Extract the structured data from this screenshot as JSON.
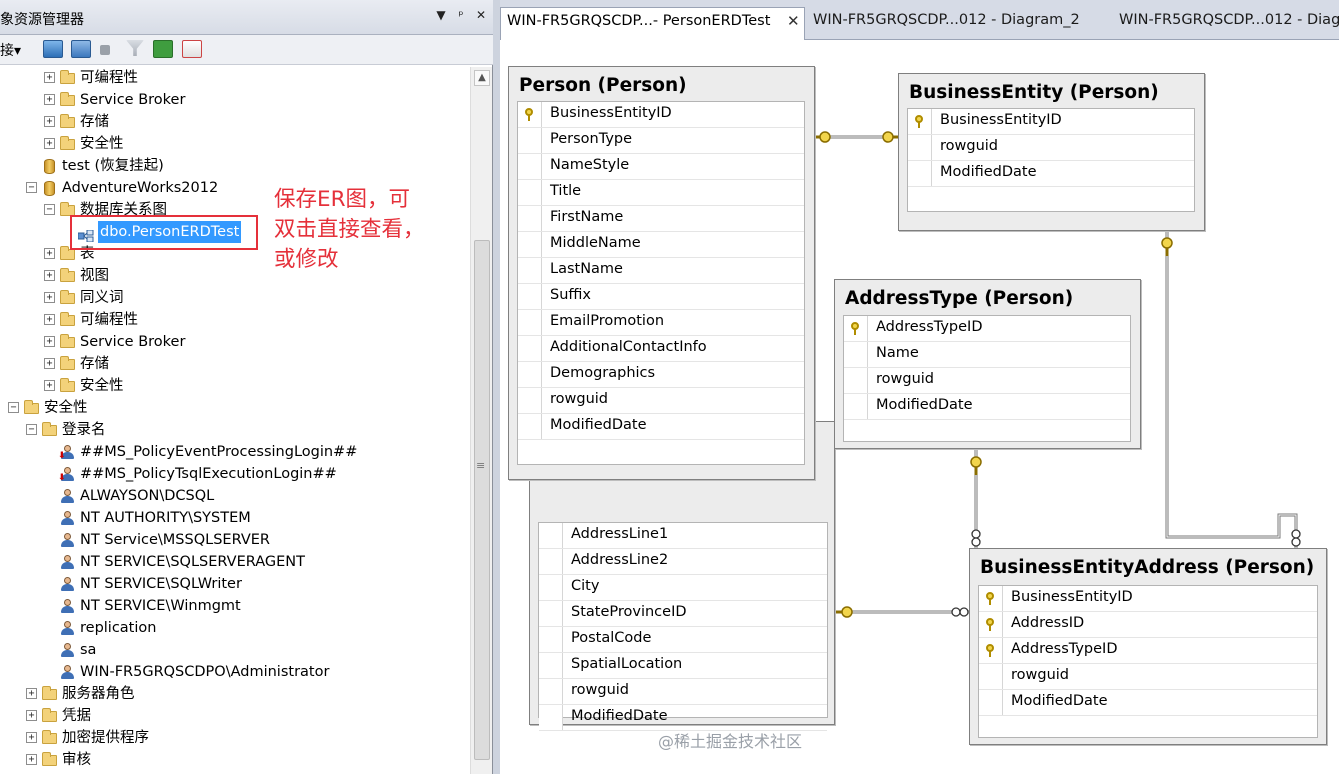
{
  "explorer": {
    "title": "象资源管理器",
    "title_buttons": [
      "▼",
      "ᵖ",
      "✕"
    ],
    "toolbar": {
      "connect_label": "连接▾"
    },
    "tree": [
      {
        "indent": 2,
        "icon": "folder",
        "expander": "+",
        "label": "可编程性"
      },
      {
        "indent": 2,
        "icon": "folder",
        "expander": "+",
        "label": "Service Broker"
      },
      {
        "indent": 2,
        "icon": "folder",
        "expander": "+",
        "label": "存储"
      },
      {
        "indent": 2,
        "icon": "folder",
        "expander": "+",
        "label": "安全性"
      },
      {
        "indent": 1,
        "icon": "database",
        "expander": "",
        "label": "test (恢复挂起)"
      },
      {
        "indent": 1,
        "icon": "database",
        "expander": "−",
        "label": "AdventureWorks2012"
      },
      {
        "indent": 2,
        "icon": "folder",
        "expander": "−",
        "label": "数据库关系图"
      },
      {
        "indent": 3,
        "icon": "diagram",
        "expander": "",
        "label": "dbo.PersonERDTest",
        "selected": true
      },
      {
        "indent": 2,
        "icon": "folder",
        "expander": "+",
        "label": "表"
      },
      {
        "indent": 2,
        "icon": "folder",
        "expander": "+",
        "label": "视图"
      },
      {
        "indent": 2,
        "icon": "folder",
        "expander": "+",
        "label": "同义词"
      },
      {
        "indent": 2,
        "icon": "folder",
        "expander": "+",
        "label": "可编程性"
      },
      {
        "indent": 2,
        "icon": "folder",
        "expander": "+",
        "label": "Service Broker"
      },
      {
        "indent": 2,
        "icon": "folder",
        "expander": "+",
        "label": "存储"
      },
      {
        "indent": 2,
        "icon": "folder",
        "expander": "+",
        "label": "安全性"
      },
      {
        "indent": 0,
        "icon": "folder",
        "expander": "−",
        "label": "安全性"
      },
      {
        "indent": 1,
        "icon": "folder",
        "expander": "−",
        "label": "登录名"
      },
      {
        "indent": 2,
        "icon": "user-disabled",
        "expander": "",
        "label": "##MS_PolicyEventProcessingLogin##"
      },
      {
        "indent": 2,
        "icon": "user-disabled",
        "expander": "",
        "label": "##MS_PolicyTsqlExecutionLogin##"
      },
      {
        "indent": 2,
        "icon": "user",
        "expander": "",
        "label": "ALWAYSON\\DCSQL"
      },
      {
        "indent": 2,
        "icon": "user",
        "expander": "",
        "label": "NT AUTHORITY\\SYSTEM"
      },
      {
        "indent": 2,
        "icon": "user",
        "expander": "",
        "label": "NT Service\\MSSQLSERVER"
      },
      {
        "indent": 2,
        "icon": "user",
        "expander": "",
        "label": "NT SERVICE\\SQLSERVERAGENT"
      },
      {
        "indent": 2,
        "icon": "user",
        "expander": "",
        "label": "NT SERVICE\\SQLWriter"
      },
      {
        "indent": 2,
        "icon": "user",
        "expander": "",
        "label": "NT SERVICE\\Winmgmt"
      },
      {
        "indent": 2,
        "icon": "user",
        "expander": "",
        "label": "replication"
      },
      {
        "indent": 2,
        "icon": "user",
        "expander": "",
        "label": "sa"
      },
      {
        "indent": 2,
        "icon": "user",
        "expander": "",
        "label": "WIN-FR5GRQSCDPO\\Administrator"
      },
      {
        "indent": 1,
        "icon": "folder",
        "expander": "+",
        "label": "服务器角色"
      },
      {
        "indent": 1,
        "icon": "folder",
        "expander": "+",
        "label": "凭据"
      },
      {
        "indent": 1,
        "icon": "folder",
        "expander": "+",
        "label": "加密提供程序"
      },
      {
        "indent": 1,
        "icon": "folder",
        "expander": "+",
        "label": "审核"
      }
    ]
  },
  "annotation": {
    "lines": [
      "保存ER图，可",
      "双击直接查看，",
      "或修改"
    ],
    "color": "#e5303a"
  },
  "tabs": [
    {
      "label": "WIN-FR5GRQSCDP...- PersonERDTest",
      "active": true,
      "close": "✕"
    },
    {
      "label": "WIN-FR5GRQSCDP...012 - Diagram_2",
      "active": false
    },
    {
      "label": "WIN-FR5GRQSCDP...012 - Diag",
      "active": false
    }
  ],
  "diagram": {
    "tables": [
      {
        "id": "person",
        "title": "Person (Person)",
        "columns": [
          {
            "name": "BusinessEntityID",
            "pk": true
          },
          {
            "name": "PersonType"
          },
          {
            "name": "NameStyle"
          },
          {
            "name": "Title"
          },
          {
            "name": "FirstName"
          },
          {
            "name": "MiddleName"
          },
          {
            "name": "LastName"
          },
          {
            "name": "Suffix"
          },
          {
            "name": "EmailPromotion"
          },
          {
            "name": "AdditionalContactInfo"
          },
          {
            "name": "Demographics"
          },
          {
            "name": "rowguid"
          },
          {
            "name": "ModifiedDate"
          }
        ]
      },
      {
        "id": "businessentity",
        "title": "BusinessEntity (Person)",
        "columns": [
          {
            "name": "BusinessEntityID",
            "pk": true
          },
          {
            "name": "rowguid"
          },
          {
            "name": "ModifiedDate"
          }
        ]
      },
      {
        "id": "addresstype",
        "title": "AddressType (Person)",
        "columns": [
          {
            "name": "AddressTypeID",
            "pk": true
          },
          {
            "name": "Name"
          },
          {
            "name": "rowguid"
          },
          {
            "name": "ModifiedDate"
          }
        ]
      },
      {
        "id": "address",
        "title": "",
        "columns": [
          {
            "name": "AddressLine1"
          },
          {
            "name": "AddressLine2"
          },
          {
            "name": "City"
          },
          {
            "name": "StateProvinceID"
          },
          {
            "name": "PostalCode"
          },
          {
            "name": "SpatialLocation"
          },
          {
            "name": "rowguid"
          },
          {
            "name": "ModifiedDate"
          }
        ]
      },
      {
        "id": "businessentityaddress",
        "title": "BusinessEntityAddress (Person)",
        "columns": [
          {
            "name": "BusinessEntityID",
            "pk": true
          },
          {
            "name": "AddressID",
            "pk": true
          },
          {
            "name": "AddressTypeID",
            "pk": true
          },
          {
            "name": "rowguid"
          },
          {
            "name": "ModifiedDate"
          }
        ]
      }
    ]
  },
  "watermark": "@稀土掘金技术社区"
}
